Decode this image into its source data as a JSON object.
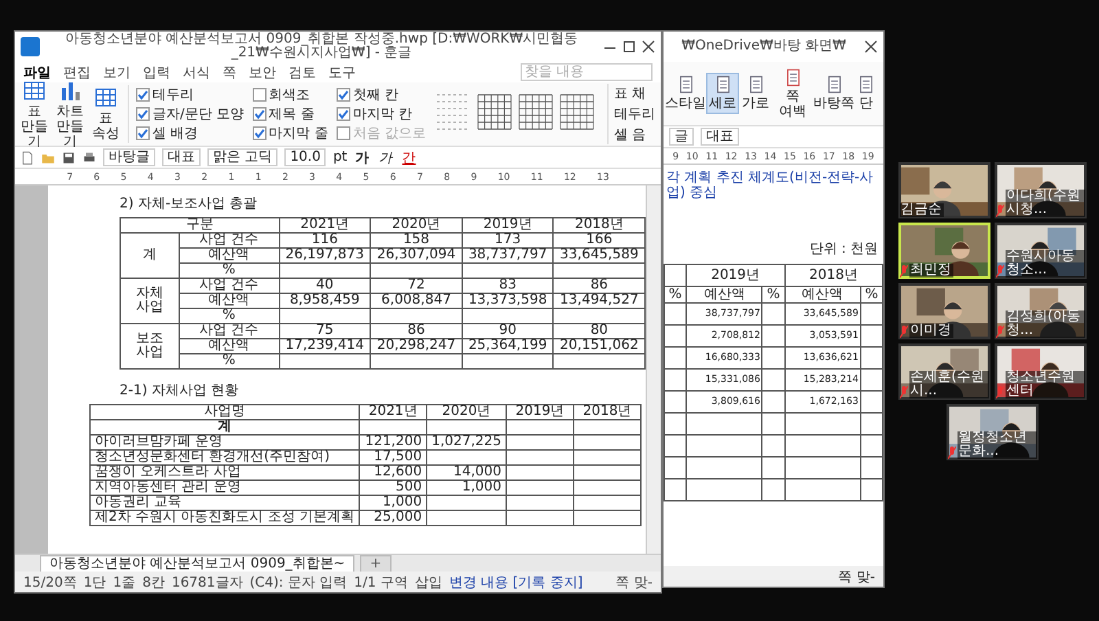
{
  "main_window": {
    "title": "아동청소년분야 예산분석보고서 0909_취합본 작성중.hwp [D:₩WORK₩시민협동_21₩수원시지사업₩] - 훈글",
    "menu": [
      {
        "label": "파일",
        "selected": true
      },
      {
        "label": "편집",
        "selected": false
      },
      {
        "label": "보기",
        "selected": false
      },
      {
        "label": "입력",
        "selected": false
      },
      {
        "label": "서식",
        "selected": false
      },
      {
        "label": "쪽",
        "selected": false
      },
      {
        "label": "보안",
        "selected": false
      },
      {
        "label": "검토",
        "selected": false
      },
      {
        "label": "도구",
        "selected": false
      }
    ],
    "search_placeholder": "찾을 내용",
    "ribbon": {
      "buttons": [
        "표 만들기",
        "차트 만들기",
        "표 속성"
      ],
      "checkboxes": [
        {
          "label": "테두리",
          "checked": true,
          "disabled": false
        },
        {
          "label": "글자/문단 모양",
          "checked": true,
          "disabled": false
        },
        {
          "label": "셀 배경",
          "checked": true,
          "disabled": false
        },
        {
          "label": "회색조",
          "checked": false,
          "disabled": false
        },
        {
          "label": "제목 줄",
          "checked": true,
          "disabled": false
        },
        {
          "label": "마지막 줄",
          "checked": true,
          "disabled": false
        },
        {
          "label": "첫째 칸",
          "checked": true,
          "disabled": false
        },
        {
          "label": "마지막 칸",
          "checked": true,
          "disabled": false
        },
        {
          "label": "처음 값으로",
          "checked": false,
          "disabled": true
        }
      ],
      "right_items": [
        "표 채",
        "테두리",
        "셀 음"
      ]
    },
    "toolbar": {
      "style": "바탕글",
      "style2": "대표",
      "font": "맑은 고딕",
      "size": "10.0",
      "unit": "pt",
      "format": [
        "가",
        "가",
        "간"
      ]
    },
    "ruler": [
      "7",
      "6",
      "5",
      "4",
      "3",
      "2",
      "1",
      "1",
      "2",
      "3",
      "4",
      "5",
      "6",
      "7",
      "8",
      "9",
      "10",
      "11",
      "12",
      "13"
    ],
    "document": {
      "heading1": "2) 자체-보조사업 총괄",
      "table1": {
        "columns": [
          "구분",
          "2021년",
          "2020년",
          "2019년",
          "2018년"
        ],
        "groups": [
          {
            "label": "계",
            "rows": [
              {
                "item": "사업 건수",
                "values": [
                  "116",
                  "158",
                  "173",
                  "166"
                ]
              },
              {
                "item": "예산액",
                "values": [
                  "26,197,873",
                  "26,307,094",
                  "38,737,797",
                  "33,645,589"
                ]
              },
              {
                "item": "%",
                "values": []
              }
            ]
          },
          {
            "label": "자체\n사업",
            "rows": [
              {
                "item": "사업 건수",
                "values": [
                  "40",
                  "72",
                  "83",
                  "86"
                ]
              },
              {
                "item": "예산액",
                "values": [
                  "8,958,459",
                  "6,008,847",
                  "13,373,598",
                  "13,494,527"
                ]
              },
              {
                "item": "%",
                "values": []
              }
            ]
          },
          {
            "label": "보조\n사업",
            "rows": [
              {
                "item": "사업 건수",
                "values": [
                  "75",
                  "86",
                  "90",
                  "80"
                ]
              },
              {
                "item": "예산액",
                "values": [
                  "17,239,414",
                  "20,298,247",
                  "25,364,199",
                  "20,151,062"
                ]
              },
              {
                "item": "%",
                "values": []
              }
            ]
          }
        ]
      },
      "heading2": "2-1) 자체사업 현황",
      "table2": {
        "columns": [
          "사업명",
          "2021년",
          "2020년",
          "2019년",
          "2018년"
        ],
        "rows": [
          {
            "kind": "total",
            "name": "계",
            "values": []
          },
          {
            "kind": "item",
            "name": "아이러브맘카페 운영",
            "values": [
              "121,200",
              "1,027,225"
            ]
          },
          {
            "kind": "item",
            "name": "청소년성문화센터 환경개선(주민참여)",
            "values": [
              "17,500"
            ]
          },
          {
            "kind": "item",
            "name": "꿈쟁이 오케스트라 사업",
            "values": [
              "12,600",
              "14,000"
            ]
          },
          {
            "kind": "item",
            "name": "지역아동센터 관리 운영",
            "values": [
              "500",
              "1,000"
            ]
          },
          {
            "kind": "item",
            "name": "아동권리 교육",
            "values": [
              "1,000"
            ]
          },
          {
            "kind": "item",
            "name": "제2차 수원시 아동친화도시 조성 기본계획",
            "values": [
              "25,000"
            ]
          }
        ]
      }
    },
    "tabs": [
      {
        "label": "아동청소년분야 예산분석보고서 0909_취합본~",
        "selected": true
      },
      {
        "label": "+",
        "selected": false
      }
    ],
    "status_bar": [
      "15/20쪽",
      "1단",
      "1줄",
      "8칸",
      "16781글자",
      "(C4): 문자 입력",
      "1/1 구역",
      "삽입",
      "변경 내용 [기록 중지]"
    ],
    "zoom_label": "쪽 맞-"
  },
  "second_window": {
    "title": "₩OneDrive₩바탕 화면₩",
    "ribbon": [
      {
        "label": "스타일",
        "selected": false
      },
      {
        "label": "세로",
        "selected": true
      },
      {
        "label": "가로",
        "selected": false
      },
      {
        "label": "쪽 여백",
        "selected": false
      },
      {
        "label": "바탕쪽",
        "selected": false
      },
      {
        "label": "단",
        "selected": false
      }
    ],
    "toolbar": [
      "글",
      "대표"
    ],
    "ruler": [
      "9",
      "10",
      "11",
      "12",
      "13",
      "14",
      "15",
      "16",
      "17",
      "18",
      "19"
    ],
    "document": {
      "line": "각 계획 추진 체계도(비전-전략-사업) 중심",
      "unit": "단위 : 천원",
      "years": [
        "2019년",
        "2018년"
      ],
      "subheaders": [
        "%",
        "예산액",
        "%",
        "예산액",
        "%"
      ],
      "rows": [
        [
          "38,737,797",
          "33,645,589"
        ],
        [
          "2,708,812",
          "3,053,591"
        ],
        [
          "16,680,333",
          "13,636,621"
        ],
        [
          "15,331,086",
          "15,283,214"
        ],
        [
          "3,809,616",
          "1,672,163"
        ],
        [],
        [],
        [],
        []
      ]
    },
    "zoom_label": "쪽 맞-"
  },
  "participants": [
    {
      "name": "김금순",
      "speaking": false,
      "muted": false
    },
    {
      "name": "이다희(수원시청...",
      "speaking": false,
      "muted": true
    },
    {
      "name": "최민정",
      "speaking": true,
      "muted": true
    },
    {
      "name": "수원시아동청소...",
      "speaking": false,
      "muted": true
    },
    {
      "name": "이미경",
      "speaking": false,
      "muted": true
    },
    {
      "name": "김성희(아동청...",
      "speaking": false,
      "muted": true
    },
    {
      "name": "손세훈(수원시...",
      "speaking": false,
      "muted": true
    },
    {
      "name": "청소년수원센터",
      "speaking": false,
      "muted": true
    },
    {
      "name": "월정청소년문화...",
      "speaking": false,
      "muted": true
    }
  ]
}
